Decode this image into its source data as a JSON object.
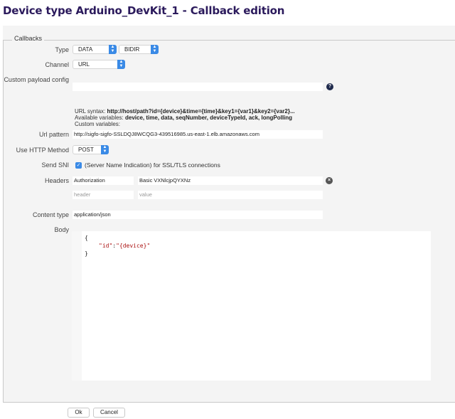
{
  "page": {
    "title": "Device type Arduino_DevKit_1 - Callback edition"
  },
  "form": {
    "legend": "Callbacks",
    "type": {
      "label": "Type",
      "value1": "DATA",
      "value2": "BIDIR"
    },
    "channel": {
      "label": "Channel",
      "value": "URL"
    },
    "custom_payload": {
      "label": "Custom payload config",
      "value": ""
    },
    "url_info": {
      "syntax_prefix": "URL syntax: ",
      "syntax_value": "http://host/path?id={device}&time={time}&key1={var1}&key2={var2}...",
      "available_prefix": "Available variables: ",
      "available_value": "device, time, data, seqNumber, deviceTypeId, ack, longPolling",
      "custom_label": "Custom variables:"
    },
    "url_pattern": {
      "label": "Url pattern",
      "value": "http://sigfo-sigfo-SSLDQJ8WCQG3-439516985.us-east-1.elb.amazonaws.com"
    },
    "http_method": {
      "label": "Use HTTP Method",
      "value": "POST"
    },
    "send_sni": {
      "label": "Send SNI",
      "checked": true,
      "text": "(Server Name Indication) for SSL/TLS connections"
    },
    "headers": {
      "label": "Headers",
      "rows": [
        {
          "header": "Authorization",
          "value": "Basic VXNlcjpQYXNz"
        }
      ],
      "header_placeholder": "header",
      "value_placeholder": "value"
    },
    "content_type": {
      "label": "Content type",
      "value": "application/json"
    },
    "body": {
      "label": "Body",
      "line1": "{",
      "line2_key": "\"id\"",
      "line2_sep": ":",
      "line2_value": "\"{device}\"",
      "line3": "}"
    }
  },
  "buttons": {
    "ok": "Ok",
    "cancel": "Cancel"
  },
  "colors": {
    "title": "#2b1a5c",
    "accent": "#3a8ae6",
    "panel": "#f4f4f4"
  },
  "icons": {
    "help": "question-circle-icon",
    "remove": "remove-circle-icon",
    "select_arrows": "updown-arrows-icon",
    "check": "check-icon"
  }
}
